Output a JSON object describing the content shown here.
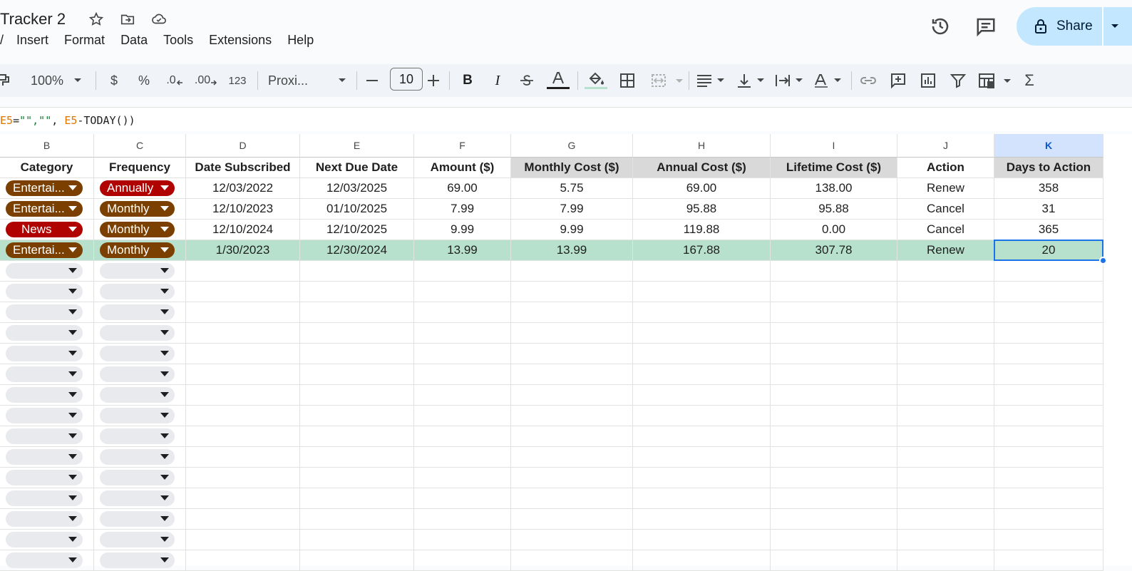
{
  "doc": {
    "title": "Tracker 2"
  },
  "menu": [
    "Insert",
    "Format",
    "Data",
    "Tools",
    "Extensions",
    "Help"
  ],
  "share_label": "Share",
  "toolbar": {
    "zoom": "100%",
    "currency": "$",
    "percent": "%",
    "dec_decrease": ".0",
    "dec_increase": ".00",
    "number_format": "123",
    "font": "Proxi...",
    "font_size": "10"
  },
  "formula": {
    "p1": "E5",
    "p2": "=",
    "p3": "\"\",\"\"",
    "p4": ", ",
    "p5": "E5",
    "p6": "-TODAY())"
  },
  "columns": [
    "B",
    "C",
    "D",
    "E",
    "F",
    "G",
    "H",
    "I",
    "J",
    "K"
  ],
  "headers": [
    "Category",
    "Frequency",
    "Date Subscribed",
    "Next Due Date",
    "Amount ($)",
    "Monthly Cost ($)",
    "Annual Cost ($)",
    "Lifetime Cost ($)",
    "Action",
    "Days to Action"
  ],
  "rows": [
    {
      "category": "Entertai...",
      "frequency": "Annually",
      "date_subscribed": "12/03/2022",
      "next_due": "12/03/2025",
      "amount": "69.00",
      "monthly": "5.75",
      "annual": "69.00",
      "lifetime": "138.00",
      "action": "Renew",
      "days": "358"
    },
    {
      "category": "Entertai...",
      "frequency": "Monthly",
      "date_subscribed": "12/10/2023",
      "next_due": "01/10/2025",
      "amount": "7.99",
      "monthly": "7.99",
      "annual": "95.88",
      "lifetime": "95.88",
      "action": "Cancel",
      "days": "31"
    },
    {
      "category": "News",
      "frequency": "Monthly",
      "date_subscribed": "12/10/2024",
      "next_due": "12/10/2025",
      "amount": "9.99",
      "monthly": "9.99",
      "annual": "119.88",
      "lifetime": "0.00",
      "action": "Cancel",
      "days": "365"
    },
    {
      "category": "Entertai...",
      "frequency": "Monthly",
      "date_subscribed": "1/30/2023",
      "next_due": "12/30/2024",
      "amount": "13.99",
      "monthly": "13.99",
      "annual": "167.88",
      "lifetime": "307.78",
      "action": "Renew",
      "days": "20"
    }
  ],
  "colors": {
    "entertainment_chip": "#7b3f00",
    "news_chip": "#b10202",
    "annually_chip": "#b10202",
    "monthly_chip": "#7b3f00",
    "selected_row": "#b7e1cd",
    "calc_header": "#d9d9d9",
    "selection": "#1a73e8"
  },
  "empty_row_count": 15
}
